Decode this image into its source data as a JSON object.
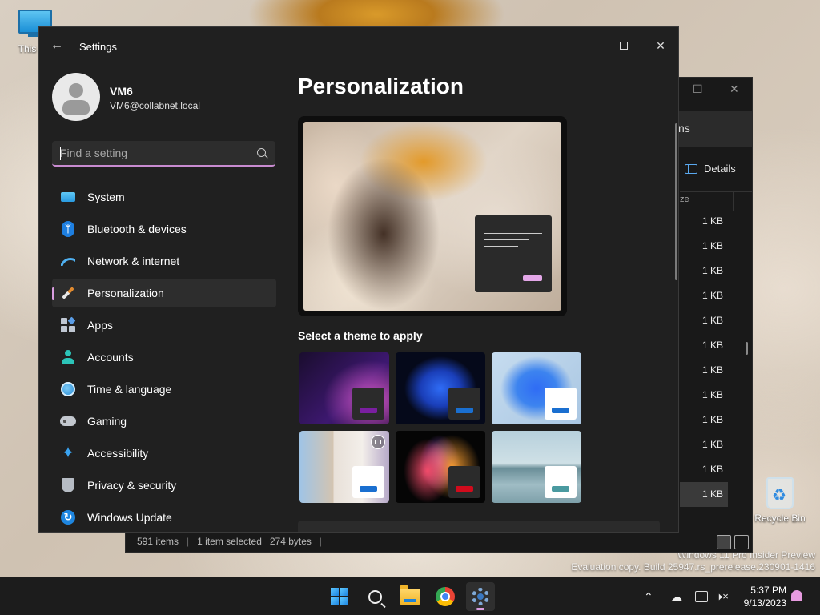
{
  "desktop": {
    "this_pc_label": "This PC",
    "recycle_bin_label": "Recycle Bin",
    "watermark_line1": "Windows 11 Pro Insider Preview",
    "watermark_line2": "Evaluation copy. Build 25947.rs_prerelease.230901-1416"
  },
  "explorer": {
    "tab_fragment": "ns",
    "details_label": "Details",
    "size_header": "ze",
    "sizes": [
      "1 KB",
      "1 KB",
      "1 KB",
      "1 KB",
      "1 KB",
      "1 KB",
      "1 KB",
      "1 KB",
      "1 KB",
      "1 KB",
      "1 KB",
      "1 KB"
    ],
    "status": {
      "items": "591 items",
      "selected": "1 item selected",
      "size": "274 bytes"
    }
  },
  "settings": {
    "app_title": "Settings",
    "back_icon": "back-arrow-icon",
    "user": {
      "name": "VM6",
      "email": "VM6@collabnet.local"
    },
    "search": {
      "placeholder": "Find a setting",
      "value": ""
    },
    "nav": [
      {
        "label": "System",
        "icon": "monitor-icon"
      },
      {
        "label": "Bluetooth & devices",
        "icon": "bluetooth-icon"
      },
      {
        "label": "Network & internet",
        "icon": "wifi-icon"
      },
      {
        "label": "Personalization",
        "icon": "paintbrush-icon",
        "active": true
      },
      {
        "label": "Apps",
        "icon": "apps-icon"
      },
      {
        "label": "Accounts",
        "icon": "person-icon"
      },
      {
        "label": "Time & language",
        "icon": "globe-clock-icon"
      },
      {
        "label": "Gaming",
        "icon": "gamepad-icon"
      },
      {
        "label": "Accessibility",
        "icon": "accessibility-icon"
      },
      {
        "label": "Privacy & security",
        "icon": "shield-icon"
      },
      {
        "label": "Windows Update",
        "icon": "update-icon"
      }
    ],
    "page_title": "Personalization",
    "theme_heading": "Select a theme to apply",
    "accent_color": "#e3a7e8",
    "themes": [
      {
        "name": "glow",
        "accent": "#7a1fa0",
        "chip": "#2b2b2b"
      },
      {
        "name": "windows-dark",
        "accent": "#1a6fd0",
        "chip": "#2b2b2b"
      },
      {
        "name": "windows-light",
        "accent": "#1a6fd0",
        "chip": "#ffffff"
      },
      {
        "name": "windows-spotlight",
        "accent": "#1a6fd0",
        "chip": "#ffffff",
        "slideshow": true
      },
      {
        "name": "captured-motion",
        "accent": "#d10b1c",
        "chip": "#2b2b2b"
      },
      {
        "name": "flow",
        "accent": "#4a9aa0",
        "chip": "#ffffff"
      }
    ]
  },
  "taskbar": {
    "apps": [
      "start-icon",
      "search-icon",
      "file-explorer-icon",
      "chrome-icon",
      "settings-icon"
    ],
    "active_app": "settings-icon",
    "time": "5:37 PM",
    "date": "9/13/2023"
  }
}
